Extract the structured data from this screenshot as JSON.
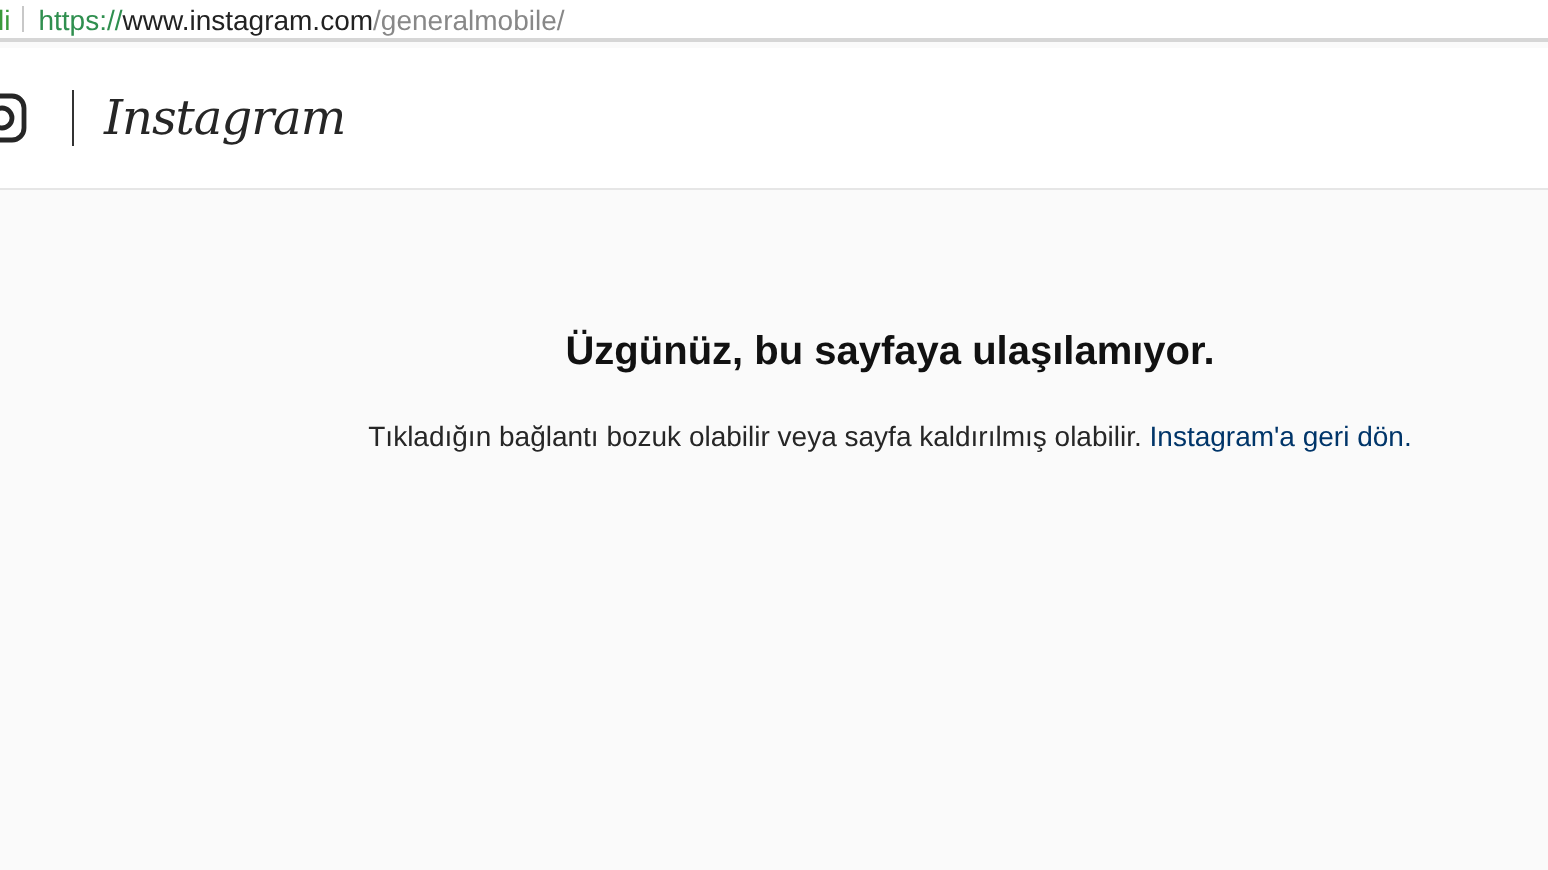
{
  "address_bar": {
    "security_label": "li",
    "scheme": "https://",
    "host": "www.instagram.com",
    "path": "/generalmobile/"
  },
  "header": {
    "logo_text": "Instagram"
  },
  "error": {
    "title": "Üzgünüz, bu sayfaya ulaşılamıyor.",
    "message": "Tıkladığın bağlantı bozuk olabilir veya sayfa kaldırılmış olabilir.",
    "link": "Instagram'a geri dön."
  }
}
